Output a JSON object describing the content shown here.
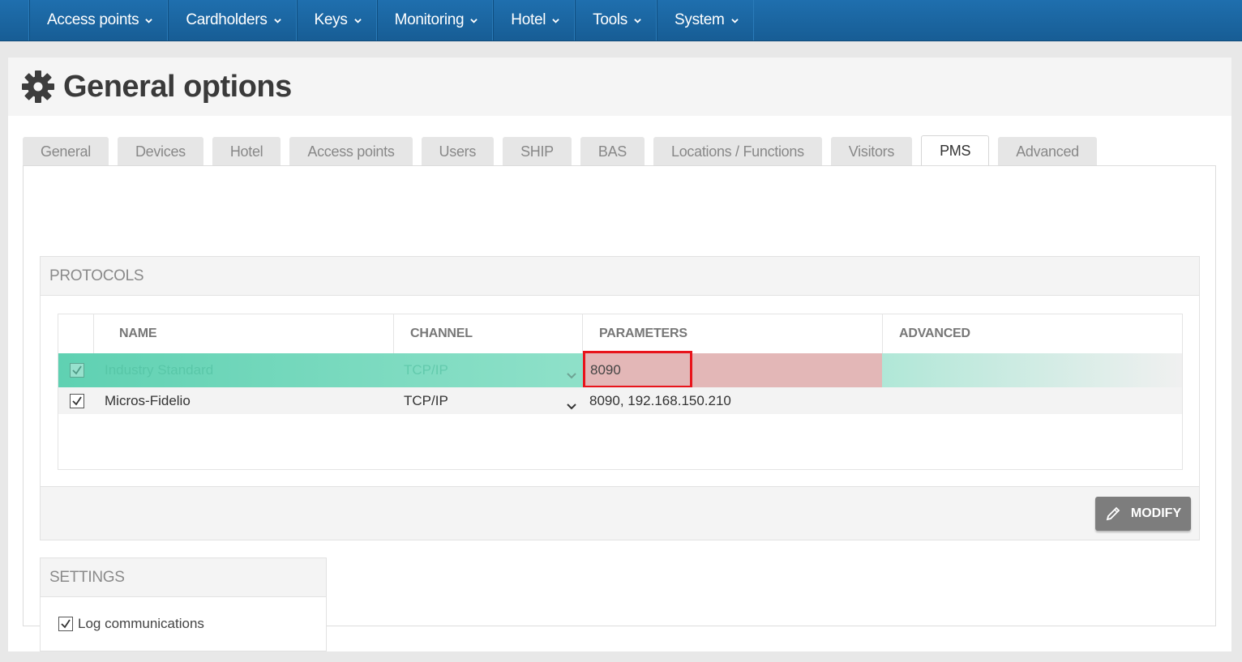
{
  "nav": {
    "items": [
      {
        "label": "Access points"
      },
      {
        "label": "Cardholders"
      },
      {
        "label": "Keys"
      },
      {
        "label": "Monitoring"
      },
      {
        "label": "Hotel"
      },
      {
        "label": "Tools"
      },
      {
        "label": "System"
      }
    ]
  },
  "page": {
    "title": "General options",
    "icon": "gear-icon"
  },
  "tabs": [
    {
      "label": "General",
      "active": false
    },
    {
      "label": "Devices",
      "active": false
    },
    {
      "label": "Hotel",
      "active": false
    },
    {
      "label": "Access points",
      "active": false
    },
    {
      "label": "Users",
      "active": false
    },
    {
      "label": "SHIP",
      "active": false
    },
    {
      "label": "BAS",
      "active": false
    },
    {
      "label": "Locations / Functions",
      "active": false
    },
    {
      "label": "Visitors",
      "active": false
    },
    {
      "label": "PMS",
      "active": true
    },
    {
      "label": "Advanced",
      "active": false
    }
  ],
  "protocols": {
    "heading": "PROTOCOLS",
    "columns": {
      "name": "NAME",
      "channel": "CHANNEL",
      "parameters": "PARAMETERS",
      "advanced": "ADVANCED"
    },
    "rows": [
      {
        "checked": true,
        "name": "Industry Standard",
        "channel": "TCP/IP",
        "parameters": "8090",
        "advanced": ""
      },
      {
        "checked": true,
        "name": "Micros-Fidelio",
        "channel": "TCP/IP",
        "parameters": "8090, 192.168.150.210",
        "advanced": ""
      }
    ],
    "modify_label": "MODIFY"
  },
  "settings": {
    "heading": "SETTINGS",
    "log_communications": {
      "label": "Log communications",
      "checked": true
    }
  },
  "colors": {
    "nav_bg": "#1f6fae",
    "highlight_row": "#5fd1b2",
    "param_highlight": "#e3b7b7",
    "param_box_border": "#e8141b",
    "modify_button": "#7d7d7d"
  }
}
